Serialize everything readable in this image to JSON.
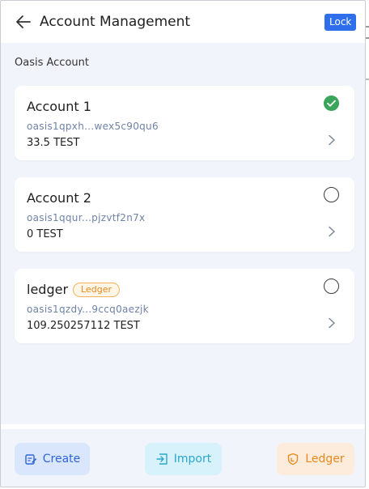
{
  "header": {
    "title": "Account Management",
    "lock_label": "Lock"
  },
  "section_label": "Oasis Account",
  "accounts": [
    {
      "name": "Account 1",
      "address": "oasis1qpxh...wex5c90qu6",
      "balance": "33.5 TEST",
      "selected": true,
      "badge": ""
    },
    {
      "name": "Account 2",
      "address": "oasis1qqur...pjzvtf2n7x",
      "balance": "0 TEST",
      "selected": false,
      "badge": ""
    },
    {
      "name": "ledger",
      "address": "oasis1qzdy...9ccq0aezjk",
      "balance": "109.250257112 TEST",
      "selected": false,
      "badge": "Ledger"
    }
  ],
  "footer": {
    "create_label": "Create",
    "import_label": "Import",
    "ledger_label": "Ledger"
  },
  "colors": {
    "accent": "#2f6fec",
    "selected_check": "#3ca55c",
    "ledger_orange": "#e6891e",
    "import_cyan": "#2aa6cf"
  }
}
